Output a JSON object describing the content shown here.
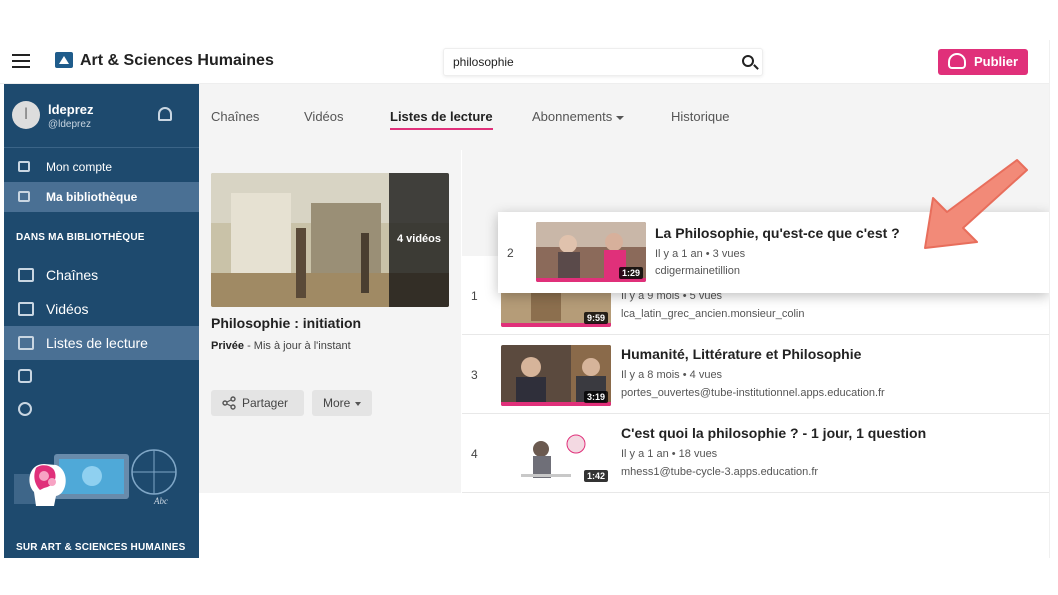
{
  "header": {
    "brand": "Art & Sciences Humaines",
    "search_value": "philosophie",
    "publish_label": "Publier"
  },
  "sidebar": {
    "user": {
      "initial": "l",
      "name": "ldeprez",
      "handle": "@ldeprez"
    },
    "account_items": [
      {
        "label": "Mon compte",
        "icon": "user-icon"
      },
      {
        "label": "Ma bibliothèque",
        "icon": "library-icon"
      }
    ],
    "library_title": "DANS MA BIBLIOTHÈQUE",
    "library_items": [
      {
        "label": "Chaînes",
        "icon": "tv-icon"
      },
      {
        "label": "Vidéos",
        "icon": "video-icon"
      },
      {
        "label": "Listes de lecture",
        "icon": "list-icon"
      }
    ],
    "footer_title": "SUR ART & SCIENCES HUMAINES"
  },
  "tabs": [
    {
      "label": "Chaînes"
    },
    {
      "label": "Vidéos"
    },
    {
      "label": "Listes de lecture"
    },
    {
      "label": "Abonnements"
    },
    {
      "label": "Historique"
    }
  ],
  "playlist": {
    "count_label": "4 vidéos",
    "title": "Philosophie : initiation",
    "privacy": "Privée",
    "updated": " - Mis à jour à l'instant",
    "share_label": "Partager",
    "more_label": "More"
  },
  "videos": [
    {
      "num": "1",
      "title": "",
      "meta": "Il y a 9 mois • 5 vues",
      "channel": "lca_latin_grec_ancien.monsieur_colin",
      "duration": "9:59"
    },
    {
      "num": "3",
      "title": "Humanité, Littérature et Philosophie",
      "meta": "Il y a 8 mois • 4 vues",
      "channel": "portes_ouvertes@tube-institutionnel.apps.education.fr",
      "duration": "3:19"
    },
    {
      "num": "4",
      "title": "C'est quoi la philosophie ? - 1 jour, 1 question",
      "meta": "Il y a 1 an • 18 vues",
      "channel": "mhess1@tube-cycle-3.apps.education.fr",
      "duration": "1:42"
    }
  ],
  "dragged": {
    "num": "2",
    "title": "La Philosophie, qu'est-ce que c'est ?",
    "meta": "Il y a 1 an • 3 vues",
    "channel": "cdigermainetillion",
    "duration": "1:29"
  },
  "colors": {
    "accent": "#e0307a",
    "sidebar": "#1e4a6e",
    "arrow": "#f28a78"
  }
}
